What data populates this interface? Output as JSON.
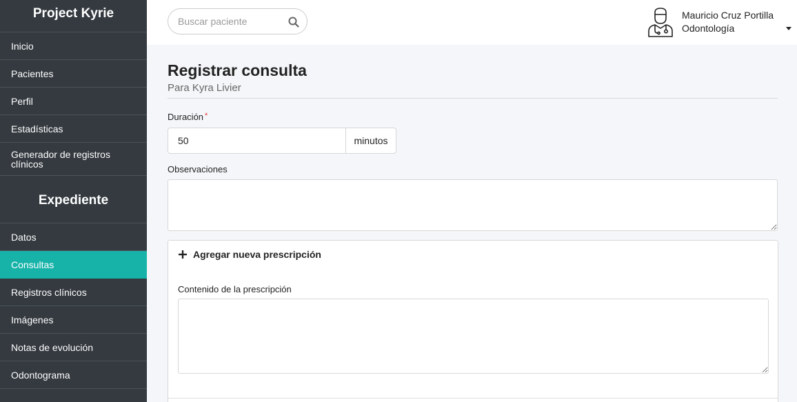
{
  "sidebar": {
    "brand": "Project Kyrie",
    "items": [
      {
        "label": "Inicio"
      },
      {
        "label": "Pacientes"
      },
      {
        "label": "Perfil"
      },
      {
        "label": "Estadísticas"
      },
      {
        "label": "Generador de registros clínicos"
      }
    ],
    "section_title": "Expediente",
    "expediente_items": [
      {
        "label": "Datos"
      },
      {
        "label": "Consultas"
      },
      {
        "label": "Registros clínicos"
      },
      {
        "label": "Imágenes"
      },
      {
        "label": "Notas de evolución"
      },
      {
        "label": "Odontograma"
      }
    ],
    "active_item": "Consultas"
  },
  "header": {
    "search": {
      "placeholder": "Buscar paciente",
      "icon": "search-icon"
    },
    "user": {
      "name": "Mauricio Cruz Portilla",
      "role": "Odontología",
      "avatar_icon": "doctor-avatar-icon"
    }
  },
  "page": {
    "title": "Registrar consulta",
    "subtitle": "Para Kyra Livier"
  },
  "form": {
    "duration": {
      "label": "Duración",
      "required_mark": "*",
      "value": "50",
      "unit": "minutos"
    },
    "observations": {
      "label": "Observaciones",
      "value": ""
    },
    "prescription": {
      "add_label": "Agregar nueva prescripción",
      "content_label": "Contenido de la prescripción",
      "content_value": ""
    }
  },
  "colors": {
    "sidebar_bg": "#343a40",
    "accent": "#17b3a9",
    "required": "#e53935"
  }
}
